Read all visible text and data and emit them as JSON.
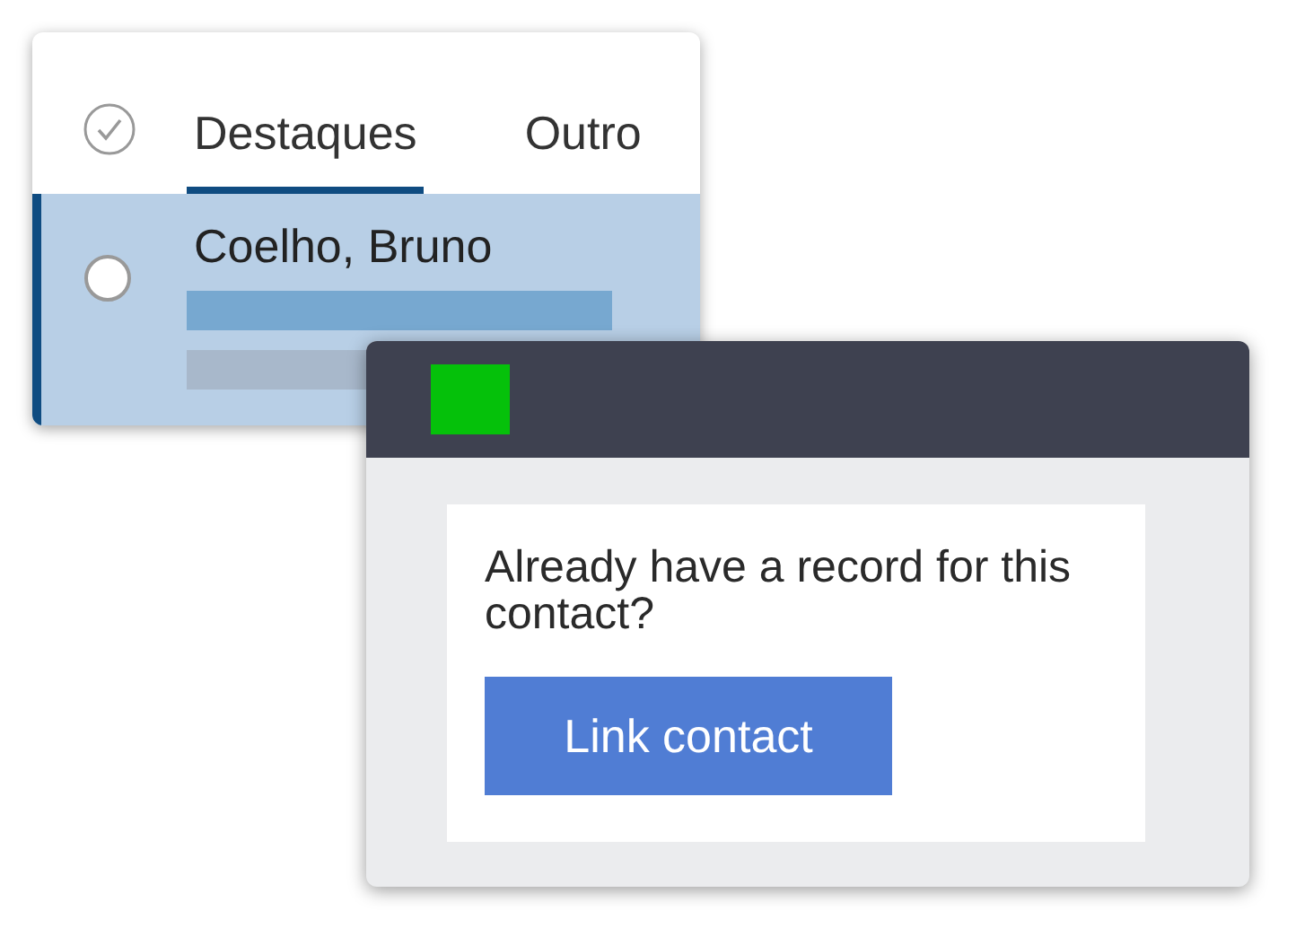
{
  "contact_list": {
    "tabs": [
      {
        "label": "Destaques",
        "selected": true
      },
      {
        "label": "Outro",
        "selected": false
      }
    ],
    "rows": [
      {
        "name": "Coelho, Bruno",
        "selected": true,
        "checked": false
      }
    ]
  },
  "dialog": {
    "prompt": "Already have a record for this contact?",
    "button": "Link contact"
  }
}
